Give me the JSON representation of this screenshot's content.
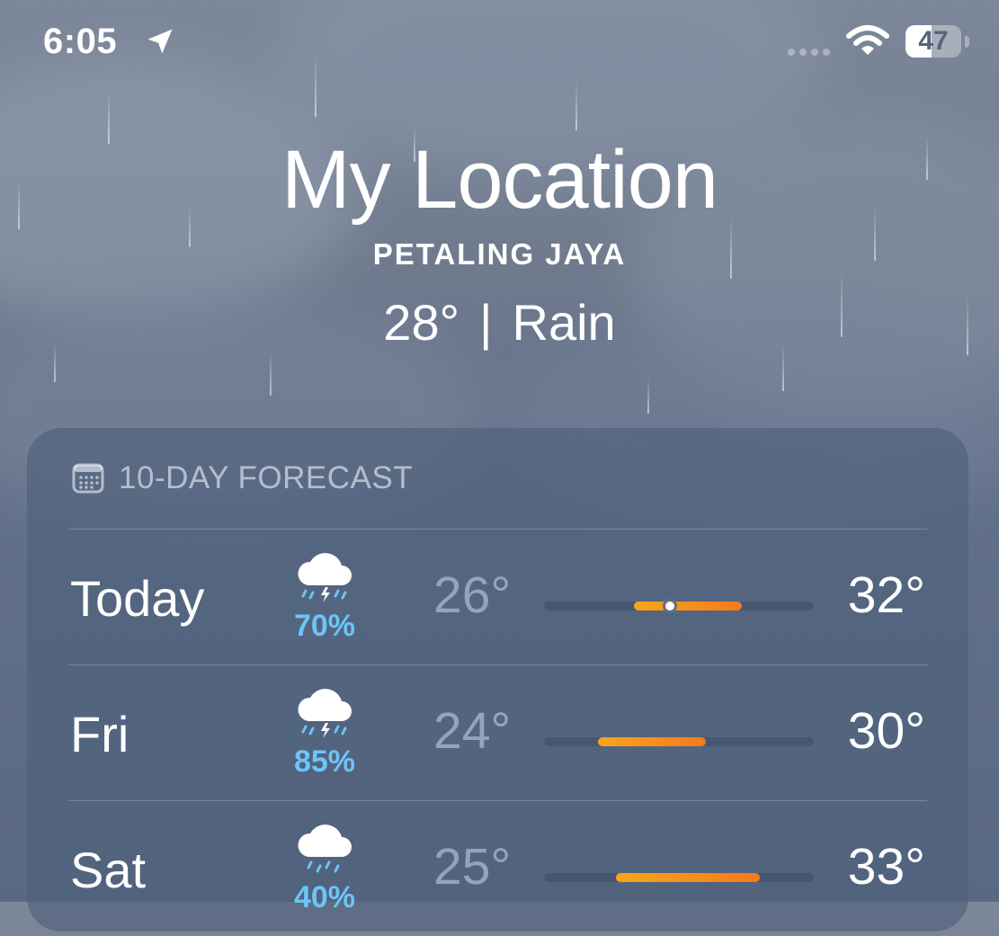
{
  "status_bar": {
    "time": "6:05",
    "battery": 47,
    "icons": [
      "location-arrow-icon",
      "signal-dots-icon",
      "wifi-icon",
      "battery-icon"
    ]
  },
  "header": {
    "title": "My Location",
    "city": "PETALING JAYA",
    "temperature": "28°",
    "separator": "|",
    "condition": "Rain"
  },
  "forecast": {
    "heading": "10-DAY FORECAST",
    "icon": "calendar-icon",
    "rows": [
      {
        "day": "Today",
        "icon": "cloud-bolt-rain-icon",
        "precip": "70%",
        "low": "26°",
        "high": "32°",
        "current": 28
      },
      {
        "day": "Fri",
        "icon": "cloud-bolt-rain-icon",
        "precip": "85%",
        "low": "24°",
        "high": "30°"
      },
      {
        "day": "Sat",
        "icon": "cloud-rain-icon",
        "precip": "40%",
        "low": "25°",
        "high": "33°"
      }
    ],
    "range_min": 21,
    "range_max": 36
  },
  "colors": {
    "precip": "#6cc5f6",
    "bar_start": "#f8a61a",
    "bar_end": "#f47a1c",
    "card": "#4e607a"
  }
}
